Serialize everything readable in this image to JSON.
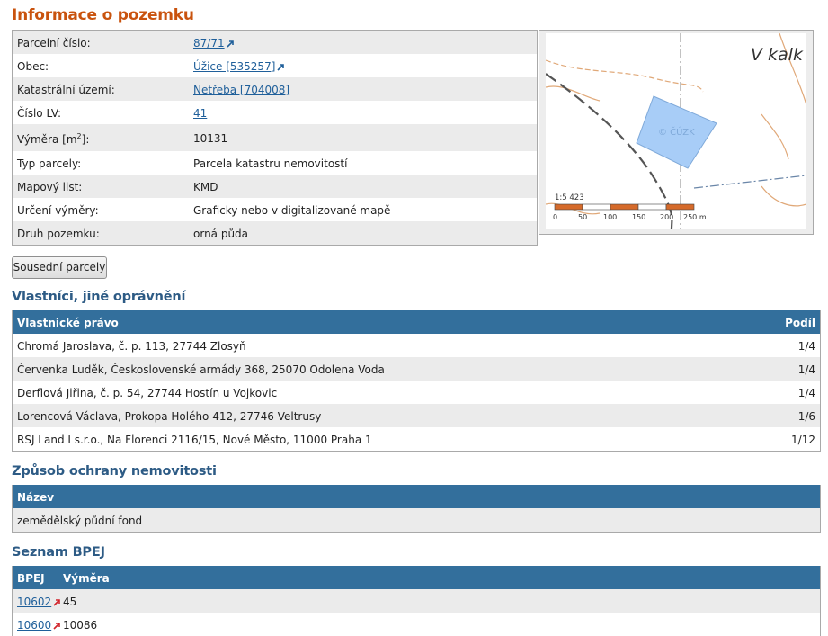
{
  "page": {
    "title": "Informace o pozemku"
  },
  "info": {
    "rows": [
      {
        "label": "Parcelní číslo:",
        "value": "87/71",
        "link": true,
        "ext": true
      },
      {
        "label": "Obec:",
        "value": "Úžice [535257]",
        "link": true,
        "ext": true
      },
      {
        "label": "Katastrální území:",
        "value": "Netřeba [704008]",
        "link": true,
        "ext": false
      },
      {
        "label": "Číslo LV:",
        "value": "41",
        "link": true,
        "ext": false
      },
      {
        "label": "Výměra [m",
        "label_sup": "2",
        "label_end": "]:",
        "value": "10131",
        "link": false,
        "ext": false
      },
      {
        "label": "Typ parcely:",
        "value": "Parcela katastru nemovitostí",
        "link": false,
        "ext": false
      },
      {
        "label": "Mapový list:",
        "value": "KMD",
        "link": false,
        "ext": false
      },
      {
        "label": "Určení výměry:",
        "value": "Graficky nebo v digitalizované mapě",
        "link": false,
        "ext": false
      },
      {
        "label": "Druh pozemku:",
        "value": "orná půda",
        "link": false,
        "ext": false
      }
    ]
  },
  "map": {
    "place_label": "V kalk",
    "scale": "1:5 423",
    "watermark": "© ČÚZK",
    "scale_ticks": [
      "0",
      "50",
      "100",
      "150",
      "200",
      "250 m"
    ],
    "colors": {
      "parcel_fill": "#a8cdf7",
      "contour": "#e0a878",
      "scale_orange": "#d56a2a"
    }
  },
  "buttons": {
    "neighbors": "Sousední parcely"
  },
  "owners": {
    "heading": "Vlastníci, jiné oprávnění",
    "col_right": "Vlastnické právo",
    "col_share": "Podíl",
    "rows": [
      {
        "name": "Chromá Jaroslava, č. p. 113, 27744 Zlosyň",
        "share": "1/4"
      },
      {
        "name": "Červenka Luděk, Československé armády 368, 25070 Odolena Voda",
        "share": "1/4"
      },
      {
        "name": "Derflová Jiřina, č. p. 54, 27744 Hostín u Vojkovic",
        "share": "1/4"
      },
      {
        "name": "Lorencová Václava, Prokopa Holého 412, 27746 Veltrusy",
        "share": "1/6"
      },
      {
        "name": "RSJ Land I s.r.o., Na Florenci 2116/15, Nové Město, 11000 Praha 1",
        "share": "1/12"
      }
    ]
  },
  "protection": {
    "heading": "Způsob ochrany nemovitosti",
    "col_name": "Název",
    "rows": [
      {
        "name": "zemědělský půdní fond"
      }
    ]
  },
  "bpej": {
    "heading": "Seznam BPEJ",
    "col_code": "BPEJ",
    "col_area": "Výměra",
    "rows": [
      {
        "code": "10602",
        "area": "45"
      },
      {
        "code": "10600",
        "area": "10086"
      }
    ]
  },
  "colors": {
    "title": "#c9530e",
    "heading": "#2d5b85",
    "table_header": "#336f9c",
    "link": "#1f5f9a"
  }
}
